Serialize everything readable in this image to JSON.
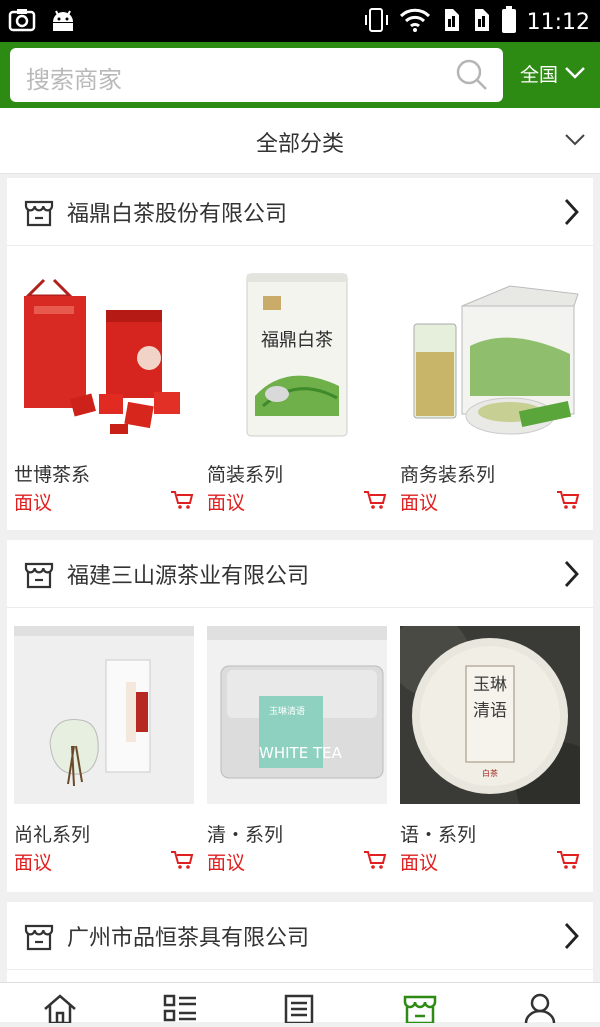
{
  "status": {
    "time": "11:12"
  },
  "header": {
    "search_placeholder": "搜索商家",
    "region": "全国"
  },
  "category": {
    "label": "全部分类"
  },
  "colors": {
    "brand_green": "#2d8a12",
    "price_red": "#e02020"
  },
  "shops": [
    {
      "name": "福鼎白茶股份有限公司",
      "products": [
        {
          "title": "世博茶系",
          "price": "面议"
        },
        {
          "title": "简装系列",
          "price": "面议"
        },
        {
          "title": "商务装系列",
          "price": "面议"
        }
      ]
    },
    {
      "name": "福建三山源茶业有限公司",
      "products": [
        {
          "title": "尚礼系列",
          "price": "面议"
        },
        {
          "title": "清・系列",
          "price": "面议"
        },
        {
          "title": "语・系列",
          "price": "面议"
        }
      ]
    },
    {
      "name": "广州市品恒茶具有限公司",
      "products": []
    }
  ],
  "package_text": {
    "white_tea": "WHITE TEA",
    "cake": "玉琳清语"
  },
  "tabbar": {
    "items": [
      "home-icon",
      "category-list-icon",
      "news-icon",
      "shop-icon",
      "user-icon"
    ]
  }
}
